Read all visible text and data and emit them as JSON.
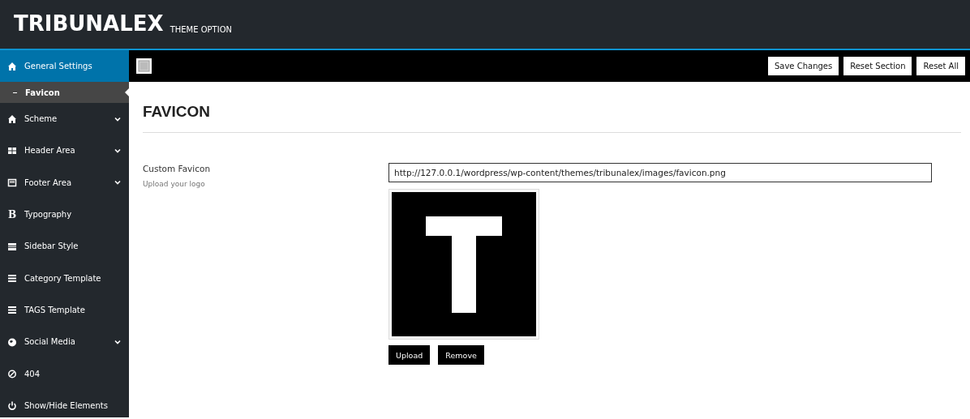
{
  "header": {
    "title": "TRIBUNALEX",
    "subtitle": "THEME OPTION"
  },
  "sidebar": {
    "items": [
      {
        "label": "General Settings",
        "selected": true,
        "has_submenu": false,
        "children": [
          {
            "label": "Favicon",
            "selected": true
          }
        ]
      },
      {
        "label": "Scheme",
        "selected": false,
        "has_submenu": true
      },
      {
        "label": "Header Area",
        "selected": false,
        "has_submenu": true
      },
      {
        "label": "Footer Area",
        "selected": false,
        "has_submenu": true
      },
      {
        "label": "Typography",
        "selected": false,
        "has_submenu": false,
        "icon_char": "B"
      },
      {
        "label": "Sidebar Style",
        "selected": false,
        "has_submenu": false
      },
      {
        "label": "Category Template",
        "selected": false,
        "has_submenu": false
      },
      {
        "label": "TAGS Template",
        "selected": false,
        "has_submenu": false
      },
      {
        "label": "Social Media",
        "selected": false,
        "has_submenu": true
      },
      {
        "label": "404",
        "selected": false,
        "has_submenu": false
      },
      {
        "label": "Show/Hide Elements",
        "selected": false,
        "has_submenu": false
      }
    ]
  },
  "toolbar": {
    "buttons": [
      "Save Changes",
      "Reset Section",
      "Reset All"
    ]
  },
  "section": {
    "title": "FAVICON",
    "field": {
      "label": "Custom Favicon",
      "description": "Upload your logo",
      "value": "http://127.0.0.1/wordpress/wp-content/themes/tribunalex/images/favicon.png",
      "buttons": [
        "Upload",
        "Remove"
      ]
    }
  }
}
